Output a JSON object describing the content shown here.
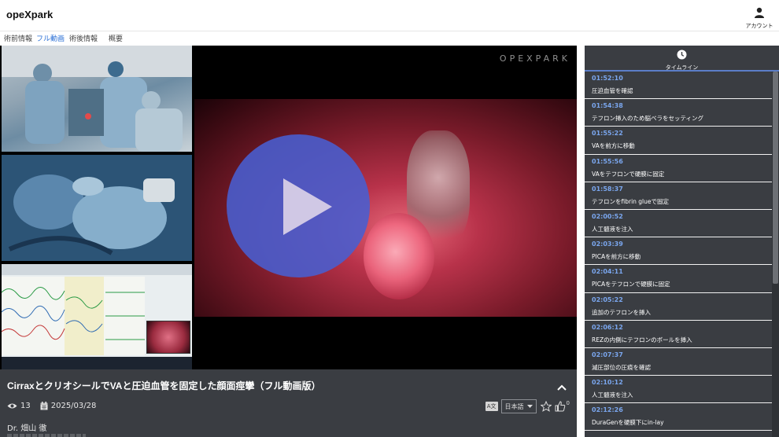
{
  "app": {
    "brand": "opeXpark"
  },
  "account": {
    "label": "アカウント",
    "icon": "user-icon"
  },
  "tabs": [
    {
      "label": "術前情報",
      "active": false
    },
    {
      "label": "フル動画",
      "active": true
    },
    {
      "label": "術後情報",
      "active": false
    },
    {
      "label": "概要",
      "active": false
    }
  ],
  "player": {
    "watermark": "OPEXPARK",
    "play_icon": "play-icon"
  },
  "video_info": {
    "title": "CirraxとクリオシールでVAと圧迫血管を固定した顔面痙攣（フル動画版）",
    "views": "13",
    "date": "2025/03/28",
    "doctor": "Dr. 畑山 徹",
    "language": "日本語",
    "likes": "0"
  },
  "timeline": {
    "label": "タイムライン",
    "items": [
      {
        "time": "01:52:10",
        "text": "圧迫血管を確認"
      },
      {
        "time": "01:54:38",
        "text": "テフロン挿入のため脳ベラをセッティング"
      },
      {
        "time": "01:55:22",
        "text": "VAを前方に移動"
      },
      {
        "time": "01:55:56",
        "text": "VAをテフロンで硬膜に固定"
      },
      {
        "time": "01:58:37",
        "text": "テフロンをfibrin glueで固定"
      },
      {
        "time": "02:00:52",
        "text": "人工髄液を注入"
      },
      {
        "time": "02:03:39",
        "text": "PICAを前方に移動"
      },
      {
        "time": "02:04:11",
        "text": "PICAをテフロンで硬膜に固定"
      },
      {
        "time": "02:05:22",
        "text": "追加のテフロンを挿入"
      },
      {
        "time": "02:06:12",
        "text": "REZの内側にテフロンのボールを挿入"
      },
      {
        "time": "02:07:37",
        "text": "減圧部位の圧痕を確認"
      },
      {
        "time": "02:10:12",
        "text": "人工髄液を注入"
      },
      {
        "time": "02:12:26",
        "text": "DuraGenを硬膜下にin-lay"
      }
    ]
  },
  "colors": {
    "accent": "#2a6fd6",
    "panel": "#3a3d42",
    "timestamp": "#7aa6ee",
    "play_button": "#485fd2"
  }
}
